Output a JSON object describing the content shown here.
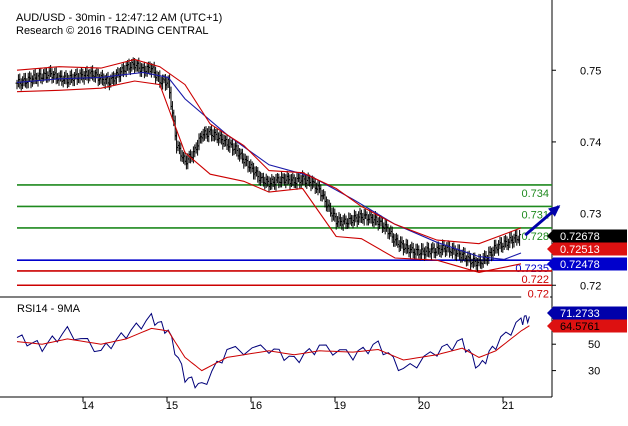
{
  "header": {
    "title": "AUD/USD - 30min - 12:47:12 AM (UTC+1)",
    "subtitle": "Research © 2016 TRADING CENTRAL"
  },
  "chart_data": [
    {
      "type": "line",
      "name": "price-panel",
      "x": [
        "14",
        "15",
        "16",
        "19",
        "20",
        "21"
      ],
      "y_ticks": [
        "0.72",
        "0.73",
        "0.74",
        "0.75"
      ],
      "ylim": [
        0.7185,
        0.7545
      ],
      "grid": false,
      "series": [
        {
          "kind": "candles",
          "color": "#000000",
          "points": [
            [
              0.0,
              0.7482
            ],
            [
              0.1,
              0.7485
            ],
            [
              0.2,
              0.7489
            ],
            [
              0.3,
              0.7492
            ],
            [
              0.4,
              0.7495
            ],
            [
              0.5,
              0.7489
            ],
            [
              0.6,
              0.7487
            ],
            [
              0.7,
              0.7491
            ],
            [
              0.8,
              0.7493
            ],
            [
              0.9,
              0.7495
            ],
            [
              1.0,
              0.7488
            ],
            [
              1.1,
              0.7484
            ],
            [
              1.2,
              0.7494
            ],
            [
              1.3,
              0.7504
            ],
            [
              1.4,
              0.7508
            ],
            [
              1.5,
              0.75
            ],
            [
              1.6,
              0.7503
            ],
            [
              1.7,
              0.7485
            ],
            [
              1.8,
              0.7483
            ],
            [
              1.9,
              0.7396
            ],
            [
              2.0,
              0.7372
            ],
            [
              2.1,
              0.7384
            ],
            [
              2.2,
              0.741
            ],
            [
              2.3,
              0.7413
            ],
            [
              2.4,
              0.7406
            ],
            [
              2.5,
              0.7398
            ],
            [
              2.6,
              0.739
            ],
            [
              2.7,
              0.7375
            ],
            [
              2.8,
              0.7362
            ],
            [
              2.9,
              0.7348
            ],
            [
              3.0,
              0.7342
            ],
            [
              3.1,
              0.7346
            ],
            [
              3.2,
              0.7348
            ],
            [
              3.3,
              0.7345
            ],
            [
              3.4,
              0.7348
            ],
            [
              3.5,
              0.7344
            ],
            [
              3.6,
              0.7333
            ],
            [
              3.7,
              0.731
            ],
            [
              3.8,
              0.729
            ],
            [
              3.9,
              0.7288
            ],
            [
              4.0,
              0.7292
            ],
            [
              4.1,
              0.7296
            ],
            [
              4.2,
              0.7294
            ],
            [
              4.3,
              0.7289
            ],
            [
              4.4,
              0.7279
            ],
            [
              4.5,
              0.7262
            ],
            [
              4.6,
              0.7254
            ],
            [
              4.7,
              0.7248
            ],
            [
              4.8,
              0.7246
            ],
            [
              4.9,
              0.7248
            ],
            [
              5.0,
              0.7249
            ],
            [
              5.1,
              0.7252
            ],
            [
              5.2,
              0.7247
            ],
            [
              5.3,
              0.7242
            ],
            [
              5.4,
              0.7234
            ],
            [
              5.5,
              0.7231
            ],
            [
              5.6,
              0.724
            ],
            [
              5.7,
              0.7253
            ],
            [
              5.8,
              0.7258
            ],
            [
              5.9,
              0.7264
            ],
            [
              6.0,
              0.7268
            ]
          ]
        },
        {
          "kind": "line",
          "name": "",
          "color": "#1a1aa8",
          "points": [
            [
              0.0,
              0.7483
            ],
            [
              0.5,
              0.7488
            ],
            [
              1.0,
              0.749
            ],
            [
              1.5,
              0.7497
            ],
            [
              1.8,
              0.749
            ],
            [
              2.0,
              0.746
            ],
            [
              2.5,
              0.741
            ],
            [
              3.0,
              0.7368
            ],
            [
              3.5,
              0.7352
            ],
            [
              4.0,
              0.732
            ],
            [
              4.5,
              0.7285
            ],
            [
              5.0,
              0.726
            ],
            [
              5.5,
              0.724
            ],
            [
              5.8,
              0.7236
            ],
            [
              6.0,
              0.7245
            ]
          ]
        },
        {
          "kind": "line",
          "name": "",
          "color": "#cc0000",
          "points": [
            [
              0.0,
              0.75
            ],
            [
              0.5,
              0.7505
            ],
            [
              1.0,
              0.7503
            ],
            [
              1.4,
              0.7515
            ],
            [
              1.7,
              0.7505
            ],
            [
              2.0,
              0.748
            ],
            [
              2.3,
              0.7425
            ],
            [
              2.7,
              0.7395
            ],
            [
              3.0,
              0.736
            ],
            [
              3.4,
              0.7357
            ],
            [
              3.8,
              0.7335
            ],
            [
              4.1,
              0.731
            ],
            [
              4.5,
              0.7285
            ],
            [
              5.0,
              0.7263
            ],
            [
              5.5,
              0.7258
            ],
            [
              6.0,
              0.728
            ]
          ]
        },
        {
          "kind": "line",
          "name": "",
          "color": "#cc0000",
          "points": [
            [
              0.0,
              0.747
            ],
            [
              0.5,
              0.7472
            ],
            [
              1.0,
              0.7475
            ],
            [
              1.4,
              0.7485
            ],
            [
              1.7,
              0.748
            ],
            [
              2.0,
              0.7385
            ],
            [
              2.3,
              0.7355
            ],
            [
              2.7,
              0.7345
            ],
            [
              3.0,
              0.733
            ],
            [
              3.4,
              0.7335
            ],
            [
              3.8,
              0.7268
            ],
            [
              4.1,
              0.7265
            ],
            [
              4.5,
              0.7238
            ],
            [
              5.0,
              0.7235
            ],
            [
              5.5,
              0.7218
            ],
            [
              6.0,
              0.723
            ]
          ]
        },
        {
          "kind": "arrow",
          "color": "#0000aa",
          "points": [
            [
              6.05,
              0.727
            ],
            [
              6.45,
              0.731
            ]
          ]
        }
      ],
      "levels": [
        {
          "label": "0.734",
          "value": 0.734,
          "color": "#1f8a1f"
        },
        {
          "label": "0.731",
          "value": 0.731,
          "color": "#1f8a1f"
        },
        {
          "label": "0.728",
          "value": 0.728,
          "color": "#1f8a1f"
        },
        {
          "label": "0.7235",
          "value": 0.7235,
          "color": "#0000cc"
        },
        {
          "label": "0.722",
          "value": 0.722,
          "color": "#cc0000"
        },
        {
          "label": "0.72",
          "value": 0.72,
          "color": "#cc0000"
        }
      ],
      "value_labels": [
        {
          "text": "0.72678",
          "value": 0.72678,
          "bg": "#000000",
          "fg": "#ffffff"
        },
        {
          "text": "0.72513",
          "value": 0.72513,
          "bg": "#dd1111",
          "fg": "#ffffff"
        },
        {
          "text": "0.72478",
          "value": 0.72478,
          "bg": "#0000cc",
          "fg": "#ffffff"
        }
      ]
    },
    {
      "type": "line",
      "name": "rsi-panel",
      "title": "RSI14 - 9MA",
      "y_ticks": [
        "30",
        "50"
      ],
      "ylim": [
        10,
        85
      ],
      "series": [
        {
          "name": "RSI14",
          "color": "#00007a",
          "points": [
            [
              0.0,
              55
            ],
            [
              0.3,
              48
            ],
            [
              0.6,
              60
            ],
            [
              1.0,
              45
            ],
            [
              1.3,
              58
            ],
            [
              1.6,
              70
            ],
            [
              1.8,
              60
            ],
            [
              2.0,
              25
            ],
            [
              2.2,
              18
            ],
            [
              2.5,
              45
            ],
            [
              3.0,
              47
            ],
            [
              3.3,
              38
            ],
            [
              3.6,
              48
            ],
            [
              4.0,
              42
            ],
            [
              4.3,
              50
            ],
            [
              4.6,
              30
            ],
            [
              5.0,
              45
            ],
            [
              5.3,
              52
            ],
            [
              5.5,
              32
            ],
            [
              5.7,
              50
            ],
            [
              6.0,
              68
            ],
            [
              6.1,
              71
            ]
          ]
        },
        {
          "name": "9MA",
          "color": "#cc0000",
          "points": [
            [
              0.0,
              52
            ],
            [
              0.3,
              50
            ],
            [
              0.6,
              54
            ],
            [
              1.0,
              50
            ],
            [
              1.3,
              54
            ],
            [
              1.6,
              62
            ],
            [
              1.8,
              60
            ],
            [
              2.0,
              40
            ],
            [
              2.2,
              30
            ],
            [
              2.5,
              40
            ],
            [
              3.0,
              45
            ],
            [
              3.3,
              42
            ],
            [
              3.6,
              45
            ],
            [
              4.0,
              44
            ],
            [
              4.3,
              46
            ],
            [
              4.6,
              38
            ],
            [
              5.0,
              42
            ],
            [
              5.3,
              47
            ],
            [
              5.5,
              40
            ],
            [
              5.7,
              45
            ],
            [
              6.0,
              60
            ],
            [
              6.1,
              64
            ]
          ]
        }
      ],
      "value_labels": [
        {
          "text": "71.2733",
          "value": 71.2733,
          "bg": "#0000aa",
          "fg": "#ffffff"
        },
        {
          "text": "64.5761",
          "value": 64.5761,
          "bg": "#dd1111",
          "fg": "#000000"
        }
      ]
    }
  ]
}
